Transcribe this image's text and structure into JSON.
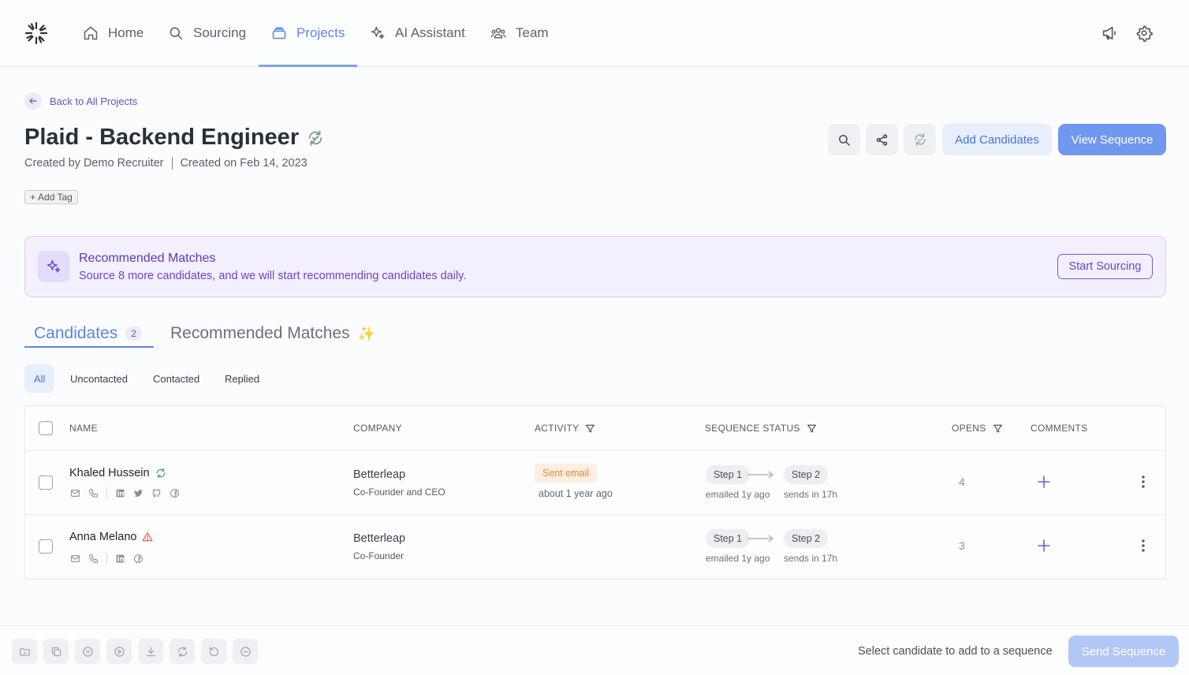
{
  "nav": {
    "items": [
      {
        "label": "Home",
        "icon": "home-icon"
      },
      {
        "label": "Sourcing",
        "icon": "search-icon"
      },
      {
        "label": "Projects",
        "icon": "projects-icon",
        "active": true
      },
      {
        "label": "AI Assistant",
        "icon": "sparkle-icon"
      },
      {
        "label": "Team",
        "icon": "team-icon"
      }
    ],
    "right_icons": [
      "megaphone-icon",
      "gear-icon"
    ]
  },
  "header": {
    "back_label": "Back to All Projects",
    "title": "Plaid - Backend Engineer",
    "created_by": "Created by Demo Recruiter",
    "created_on": "Created on Feb 14, 2023",
    "add_tag": "Add Tag",
    "add_candidates": "Add Candidates",
    "view_sequence": "View Sequence"
  },
  "banner": {
    "title": "Recommended Matches",
    "subtitle": "Source 8 more candidates, and we will start recommending candidates daily.",
    "button": "Start Sourcing"
  },
  "tabs": {
    "candidates_label": "Candidates",
    "candidates_count": "2",
    "recommended_label": "Recommended Matches",
    "recommended_emoji": "✨"
  },
  "filters": [
    "All",
    "Uncontacted",
    "Contacted",
    "Replied"
  ],
  "table": {
    "headers": {
      "name": "NAME",
      "company": "COMPANY",
      "activity": "ACTIVITY",
      "sequence_status": "SEQUENCE STATUS",
      "opens": "OPENS",
      "comments": "COMMENTS"
    },
    "rows": [
      {
        "name": "Khaled Hussein",
        "company": "Betterleap",
        "role": "Co-Founder and CEO",
        "activity_badge": "Sent email",
        "activity_time": "about 1 year ago",
        "step1": "Step 1",
        "step1_sub": "emailed 1y ago",
        "step2": "Step 2",
        "step2_sub": "sends in 17h",
        "opens": "4"
      },
      {
        "name": "Anna Melano",
        "company": "Betterleap",
        "role": "Co-Founder",
        "activity_badge": "",
        "activity_time": "",
        "step1": "Step 1",
        "step1_sub": "emailed 1y ago",
        "step2": "Step 2",
        "step2_sub": "sends in 17h",
        "opens": "3"
      }
    ]
  },
  "bottom": {
    "hint": "Select candidate to add to a sequence",
    "send_button": "Send Sequence"
  },
  "colors": {
    "accent": "#5b86e5",
    "primary_button": "#6f98ee",
    "purple": "#6b4fc4",
    "banner_bg": "#f3effd",
    "badge_orange": "#e28a3b",
    "sync_green": "#3fb06b",
    "warning_red": "#e0533d"
  }
}
